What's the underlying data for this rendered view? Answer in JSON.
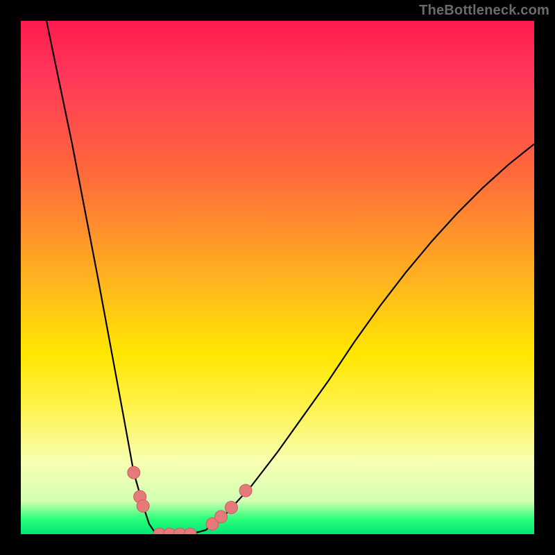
{
  "watermark": "TheBottleneck.com",
  "chart_data": {
    "type": "line",
    "title": "",
    "xlabel": "",
    "ylabel": "",
    "xlim": [
      0,
      100
    ],
    "ylim": [
      0,
      100
    ],
    "series": [
      {
        "name": "bottleneck-curve",
        "x": [
          5,
          10,
          15,
          20,
          22,
          24,
          25,
          26,
          27,
          28,
          30,
          33,
          36,
          40,
          45,
          50,
          55,
          60,
          65,
          70,
          75,
          80,
          85,
          90,
          95,
          100
        ],
        "values": [
          100,
          76,
          50,
          23,
          12,
          5,
          2,
          0.5,
          0,
          0,
          0,
          0,
          0.8,
          4,
          9.5,
          16,
          23,
          30,
          37.5,
          44.5,
          51,
          57,
          62.5,
          67.5,
          72,
          76
        ]
      }
    ],
    "markers": [
      {
        "name": "marker-left-1",
        "x": 22.0,
        "y": 12.0
      },
      {
        "name": "marker-left-2",
        "x": 23.2,
        "y": 7.3
      },
      {
        "name": "marker-left-3",
        "x": 23.8,
        "y": 5.5
      },
      {
        "name": "marker-bottom-1",
        "x": 27.0,
        "y": 0.0
      },
      {
        "name": "marker-bottom-2",
        "x": 29.0,
        "y": 0.0
      },
      {
        "name": "marker-bottom-3",
        "x": 31.0,
        "y": 0.0
      },
      {
        "name": "marker-bottom-4",
        "x": 33.0,
        "y": 0.0
      },
      {
        "name": "marker-right-1",
        "x": 37.3,
        "y": 2.0
      },
      {
        "name": "marker-right-2",
        "x": 39.0,
        "y": 3.4
      },
      {
        "name": "marker-right-3",
        "x": 41.0,
        "y": 5.2
      },
      {
        "name": "marker-right-4",
        "x": 43.8,
        "y": 8.5
      }
    ],
    "colors": {
      "curve": "#000000",
      "marker_fill": "#e47a7a",
      "marker_stroke": "#cc5f5f",
      "gradient_top": "#ff1a4d",
      "gradient_mid": "#ffe700",
      "gradient_bottom": "#00e676"
    }
  }
}
